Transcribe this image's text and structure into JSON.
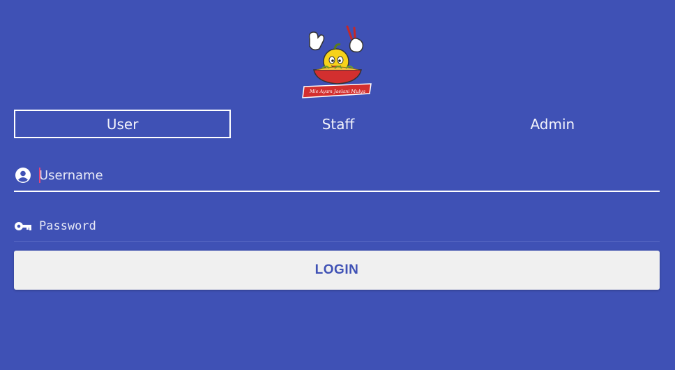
{
  "app": {
    "brand_logo_text": "Mie Ayam Jaelani Mulya",
    "accent_color": "#3F51B5"
  },
  "tabs": [
    {
      "label": "User",
      "selected": true
    },
    {
      "label": "Staff",
      "selected": false
    },
    {
      "label": "Admin",
      "selected": false
    }
  ],
  "form": {
    "username": {
      "placeholder": "Username",
      "value": "",
      "icon": "account-circle-icon"
    },
    "password": {
      "placeholder": "Password",
      "value": "",
      "icon": "key-icon"
    },
    "login_label": "LOGIN"
  }
}
